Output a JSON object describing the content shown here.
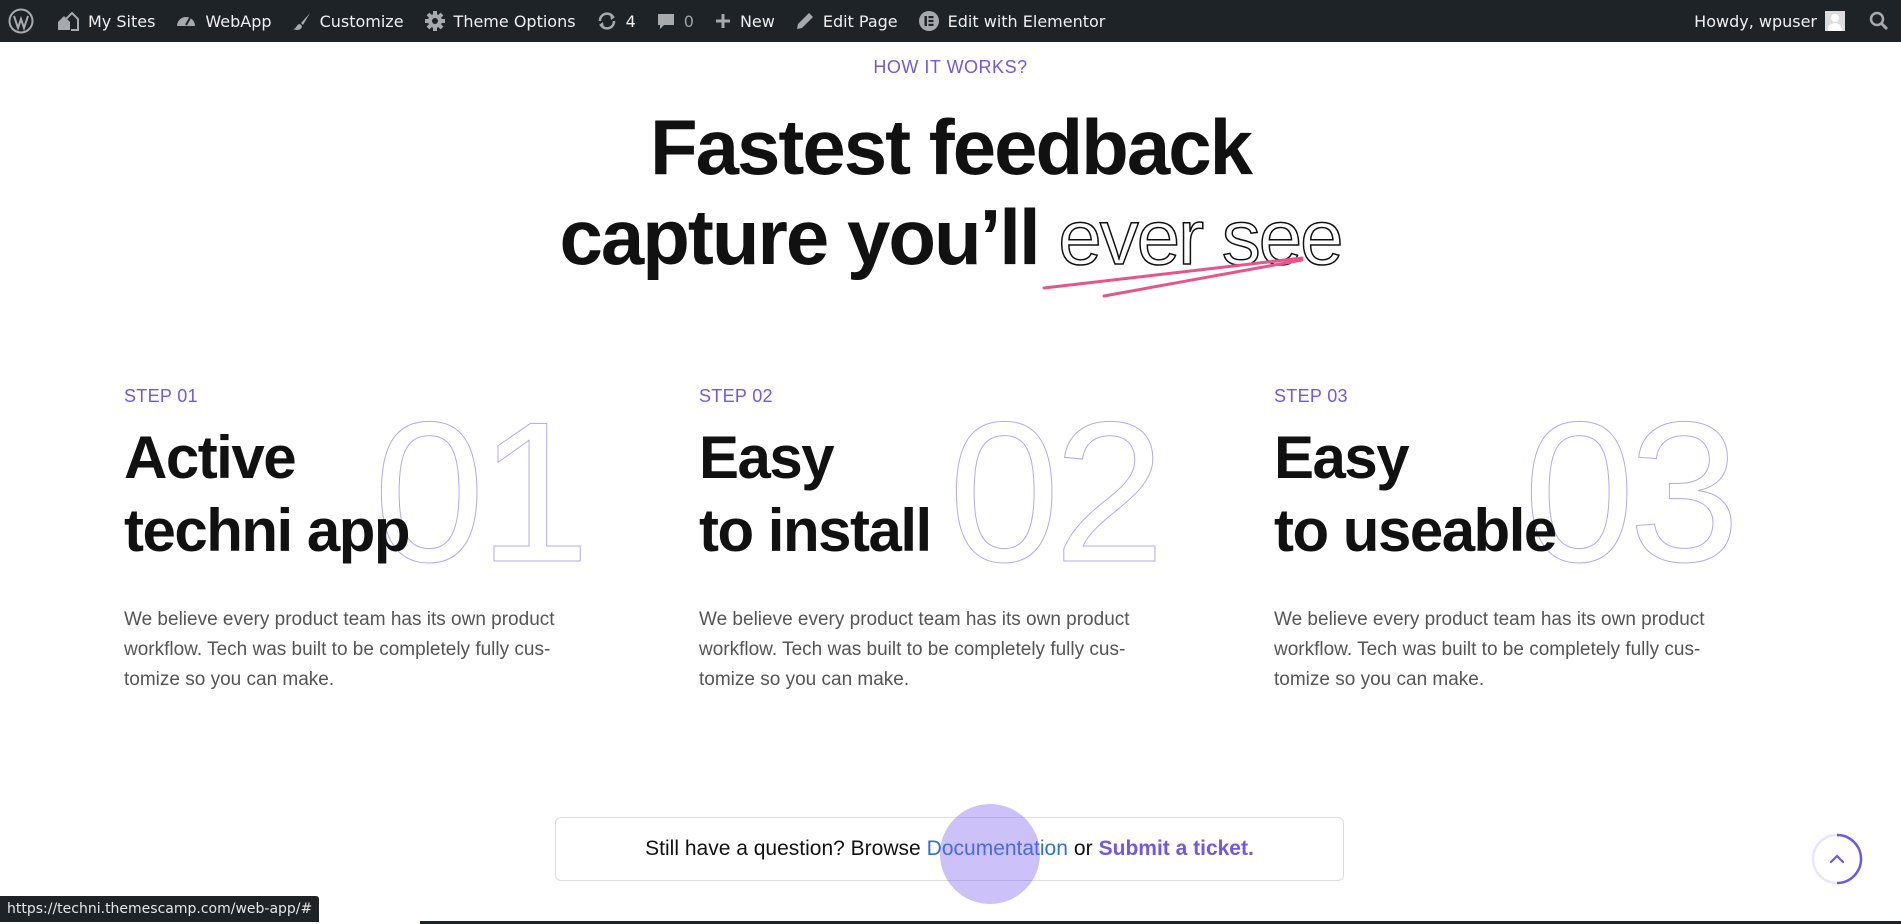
{
  "admin_bar": {
    "my_sites": "My Sites",
    "site_name": "WebApp",
    "customize": "Customize",
    "theme_options": "Theme Options",
    "updates_count": "4",
    "comments_count": "0",
    "new": "New",
    "edit_page": "Edit Page",
    "edit_elementor": "Edit with Elementor",
    "howdy": "Howdy, wpuser"
  },
  "hero": {
    "eyebrow": "HOW IT WORKS?",
    "line1": "Fastest feedback",
    "line2_start": "capture you’ll",
    "line2_outline": "ever see",
    "accent_color": "#e8548a"
  },
  "steps": [
    {
      "label": "STEP 01",
      "number": "01",
      "title_line1": "Active",
      "title_line2": "techni app",
      "text": "We believe every product team has its own product workflow. Tech was built to be completely fully cus-tomize so you can make."
    },
    {
      "label": "STEP 02",
      "number": "02",
      "title_line1": "Easy",
      "title_line2": "to install",
      "text": "We believe every product team has its own product workflow. Tech was built to be completely fully cus-tomize so you can make."
    },
    {
      "label": "STEP 03",
      "number": "03",
      "title_line1": "Easy",
      "title_line2": "to useable",
      "text": "We believe every product team has its own product workflow. Tech was built to be completely fully cus-tomize so you can make."
    }
  ],
  "help": {
    "prefix": "Still have a question? Browse",
    "documentation": "Documentation",
    "or": "or",
    "ticket": "Submit a ticket."
  },
  "status_url": "https://techni.themescamp.com/web-app/#",
  "colors": {
    "brand_purple": "#6f58e8",
    "admin_bar_bg": "#1d2327",
    "link_blue": "#2f6fde"
  }
}
